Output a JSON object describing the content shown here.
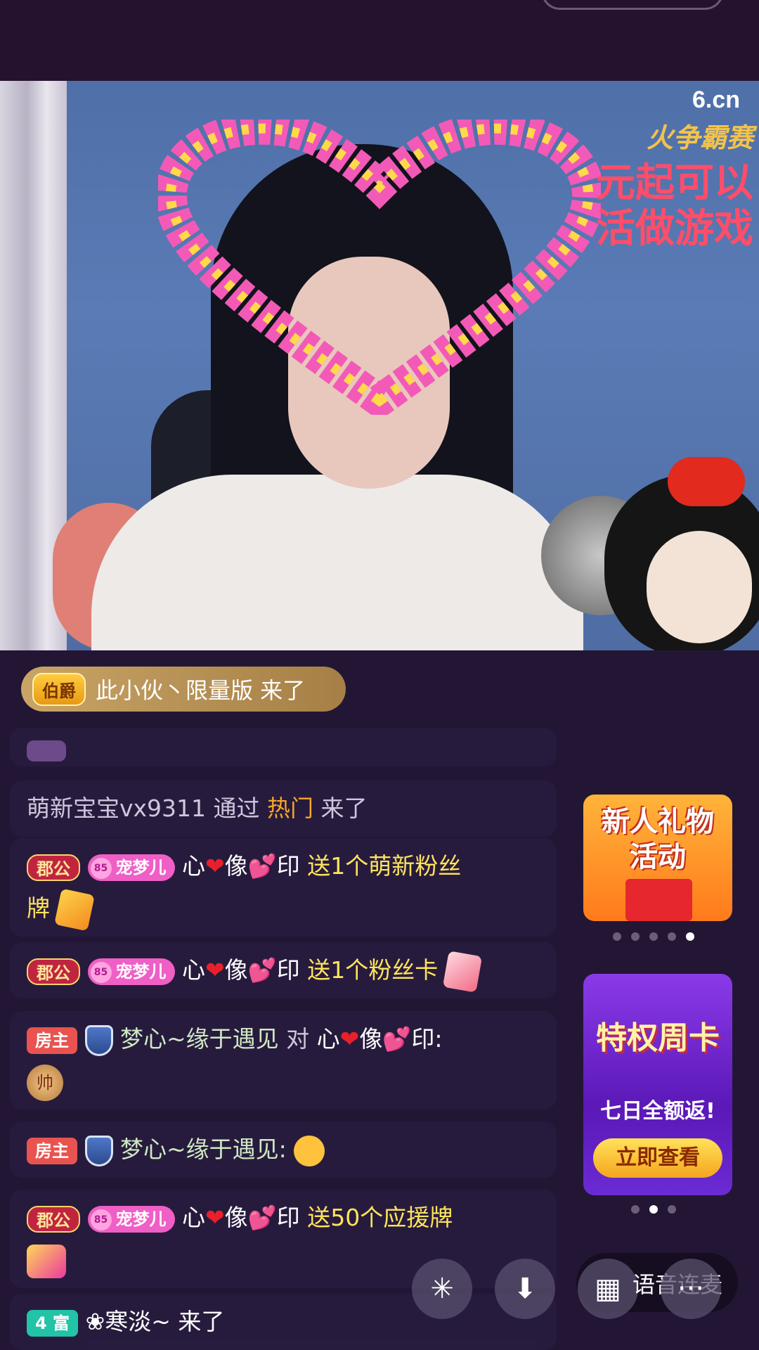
{
  "video": {
    "logo": "6.cn",
    "overlay_line1": "火争霸赛",
    "overlay_line2": "元起可以",
    "overlay_line3": "活做游戏"
  },
  "arrival": {
    "badge": "伯爵",
    "text": "此小伙丶限量版 来了"
  },
  "chat": [
    {
      "user": "萌新宝宝vx9311",
      "via": "通过",
      "source": "热门",
      "action": "来了"
    },
    {
      "rank": "郡公",
      "level": "85",
      "tag": "宠梦儿",
      "name_a": "心",
      "name_b": "像",
      "name_c": "印",
      "action": "送1个萌新粉丝",
      "action2": "牌"
    },
    {
      "rank": "郡公",
      "level": "85",
      "tag": "宠梦儿",
      "name_a": "心",
      "name_b": "像",
      "name_c": "印",
      "action": "送1个粉丝卡"
    },
    {
      "rank": "房主",
      "user": "梦心~缘于遇见",
      "to": "对",
      "name_a": "心",
      "name_b": "像",
      "name_c": "印:",
      "coin": "帅"
    },
    {
      "rank": "房主",
      "user": "梦心~缘于遇见:"
    },
    {
      "rank": "郡公",
      "level": "85",
      "tag": "宠梦儿",
      "name_a": "心",
      "name_b": "像",
      "name_c": "印",
      "action": "送50个应援牌"
    },
    {
      "rank": "4 富",
      "user": "❀寒淡~",
      "action": "来了"
    }
  ],
  "ads": {
    "ad1_title": "新人礼物\n活动",
    "ad2_title": "特权周卡",
    "ad2_sub": "七日全额返!",
    "ad2_button": "立即查看"
  },
  "controls": {
    "voice_label": "语音连麦",
    "more": "···"
  },
  "colors": {
    "background": "#231634",
    "highlight_yellow": "#ffe45c",
    "source_orange": "#f5a52b"
  }
}
